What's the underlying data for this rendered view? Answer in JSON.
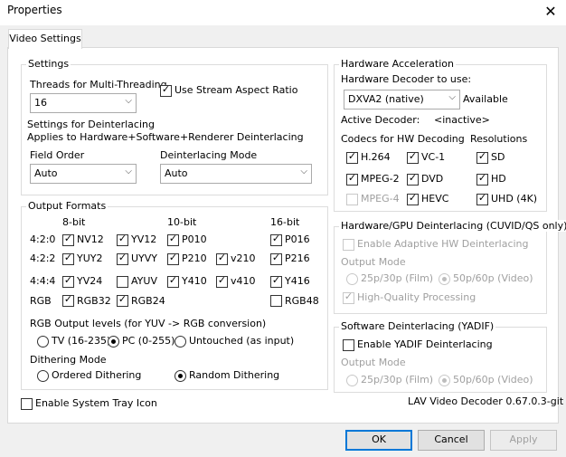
{
  "window": {
    "title": "Properties",
    "close_glyph": "✕"
  },
  "tabs": [
    {
      "label": "Video Settings"
    }
  ],
  "settings": {
    "group_label": "Settings",
    "threads_label": "Threads for Multi-Threading",
    "threads_value": "16",
    "stream_aspect_label": "Use Stream Aspect Ratio",
    "deint_heading": "Settings for Deinterlacing",
    "deint_sub": "Applies to Hardware+Software+Renderer Deinterlacing",
    "field_order_label": "Field Order",
    "field_order_value": "Auto",
    "deint_mode_label": "Deinterlacing Mode",
    "deint_mode_value": "Auto"
  },
  "output": {
    "group_label": "Output Formats",
    "col_8bit": "8-bit",
    "col_10bit": "10-bit",
    "col_16bit": "16-bit",
    "row_420": "4:2:0",
    "row_422": "4:2:2",
    "row_444": "4:4:4",
    "row_rgb": "RGB",
    "nv12": "NV12",
    "yv12": "YV12",
    "p010": "P010",
    "p016": "P016",
    "yuy2": "YUY2",
    "uyvy": "UYVY",
    "p210": "P210",
    "v210": "v210",
    "p216": "P216",
    "yv24": "YV24",
    "ayuv": "AYUV",
    "y410": "Y410",
    "v410": "v410",
    "y416": "Y416",
    "rgb32": "RGB32",
    "rgb24": "RGB24",
    "rgb48": "RGB48",
    "levels_label": "RGB Output levels (for YUV -> RGB conversion)",
    "level_tv": "TV (16-235)",
    "level_pc": "PC (0-255)",
    "level_untouched": "Untouched (as input)",
    "dither_label": "Dithering Mode",
    "dither_ordered": "Ordered Dithering",
    "dither_random": "Random Dithering"
  },
  "hwaccel": {
    "group_label": "Hardware Acceleration",
    "decoder_label": "Hardware Decoder to use:",
    "decoder_value": "DXVA2 (native)",
    "available": "Available",
    "active_label": "Active Decoder:",
    "active_value": "<inactive>",
    "codecs_label": "Codecs for HW Decoding",
    "resolutions_label": "Resolutions",
    "h264": "H.264",
    "vc1": "VC-1",
    "sd": "SD",
    "mpeg2": "MPEG-2",
    "dvd": "DVD",
    "hd": "HD",
    "mpeg4": "MPEG-4",
    "hevc": "HEVC",
    "uhd": "UHD (4K)"
  },
  "hwdeint": {
    "group_label": "Hardware/GPU Deinterlacing (CUVID/QS only)",
    "adaptive": "Enable Adaptive HW Deinterlacing",
    "output_mode": "Output Mode",
    "film": "25p/30p (Film)",
    "video": "50p/60p (Video)",
    "hq": "High-Quality Processing"
  },
  "swdeint": {
    "group_label": "Software Deinterlacing (YADIF)",
    "enable": "Enable YADIF Deinterlacing",
    "output_mode": "Output Mode",
    "film": "25p/30p (Film)",
    "video": "50p/60p (Video)"
  },
  "footer": {
    "tray": "Enable System Tray Icon",
    "version": "LAV Video Decoder 0.67.0.3-git",
    "ok": "OK",
    "cancel": "Cancel",
    "apply": "Apply"
  },
  "icons": {
    "check": "✓",
    "dropdown": "⌵"
  },
  "colors": {
    "accent": "#0078d7",
    "disabled_text": "#a0a0a0"
  }
}
